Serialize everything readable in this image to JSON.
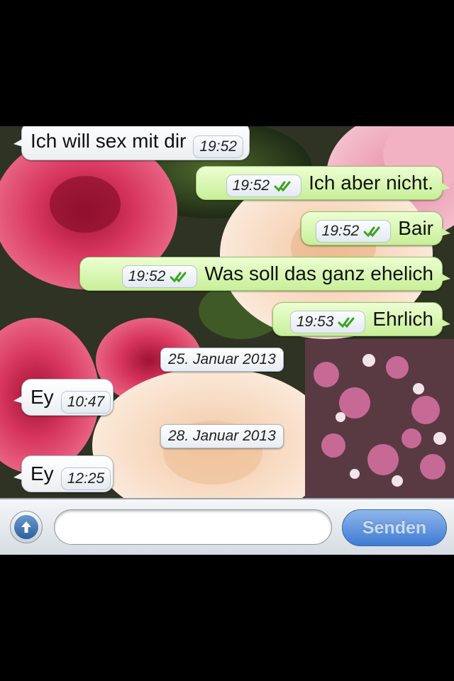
{
  "messages": [
    {
      "direction": "in",
      "text": "Ich will sex mit dir",
      "time": "19:52"
    },
    {
      "direction": "out",
      "text": "Ich aber nicht.",
      "time": "19:52",
      "status": "double-check-icon"
    },
    {
      "direction": "out",
      "text": "Bair",
      "time": "19:52",
      "status": "double-check-icon"
    },
    {
      "direction": "out",
      "text": "Was soll das ganz ehelich",
      "time": "19:52",
      "status": "double-check-icon"
    },
    {
      "direction": "out",
      "text": "Ehrlich",
      "time": "19:53",
      "status": "double-check-icon"
    },
    {
      "direction": "in",
      "text": "Ey",
      "time": "10:47"
    },
    {
      "direction": "in",
      "text": "Ey",
      "time": "12:25"
    }
  ],
  "date_separators": [
    "25. Januar 2013",
    "28. Januar 2013"
  ],
  "input_bar": {
    "text_value": "",
    "send_label": "Senden",
    "attach_icon": "arrow-up-circle-icon"
  },
  "colors": {
    "outgoing_bubble": "#cff2a3",
    "incoming_bubble": "#ffffff",
    "send_button": "#3f7bd3",
    "check_mark": "#3aa51c"
  }
}
